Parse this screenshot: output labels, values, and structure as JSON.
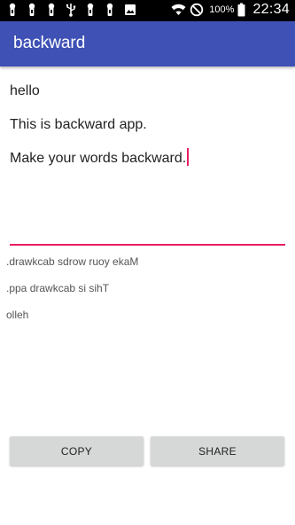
{
  "status_bar": {
    "battery_percent": "100%",
    "time": "22:34",
    "left_icons": [
      "keyhole-icon",
      "keyhole-icon",
      "keyhole-icon",
      "usb-icon",
      "keyhole-icon",
      "keyhole-icon",
      "image-icon"
    ],
    "right_icons": [
      "wifi-icon",
      "do-not-disturb-icon",
      "battery-icon"
    ]
  },
  "app_bar": {
    "title": "backward",
    "color": "#3f51b5"
  },
  "input": {
    "lines": [
      "hello",
      "This is backward app.",
      "Make your words backward."
    ],
    "accent_color": "#e91e63"
  },
  "output": {
    "lines": [
      ".drawkcab sdrow ruoy ekaM",
      ".ppa drawkcab si sihT",
      "olleh"
    ]
  },
  "buttons": {
    "copy_label": "COPY",
    "share_label": "SHARE"
  }
}
